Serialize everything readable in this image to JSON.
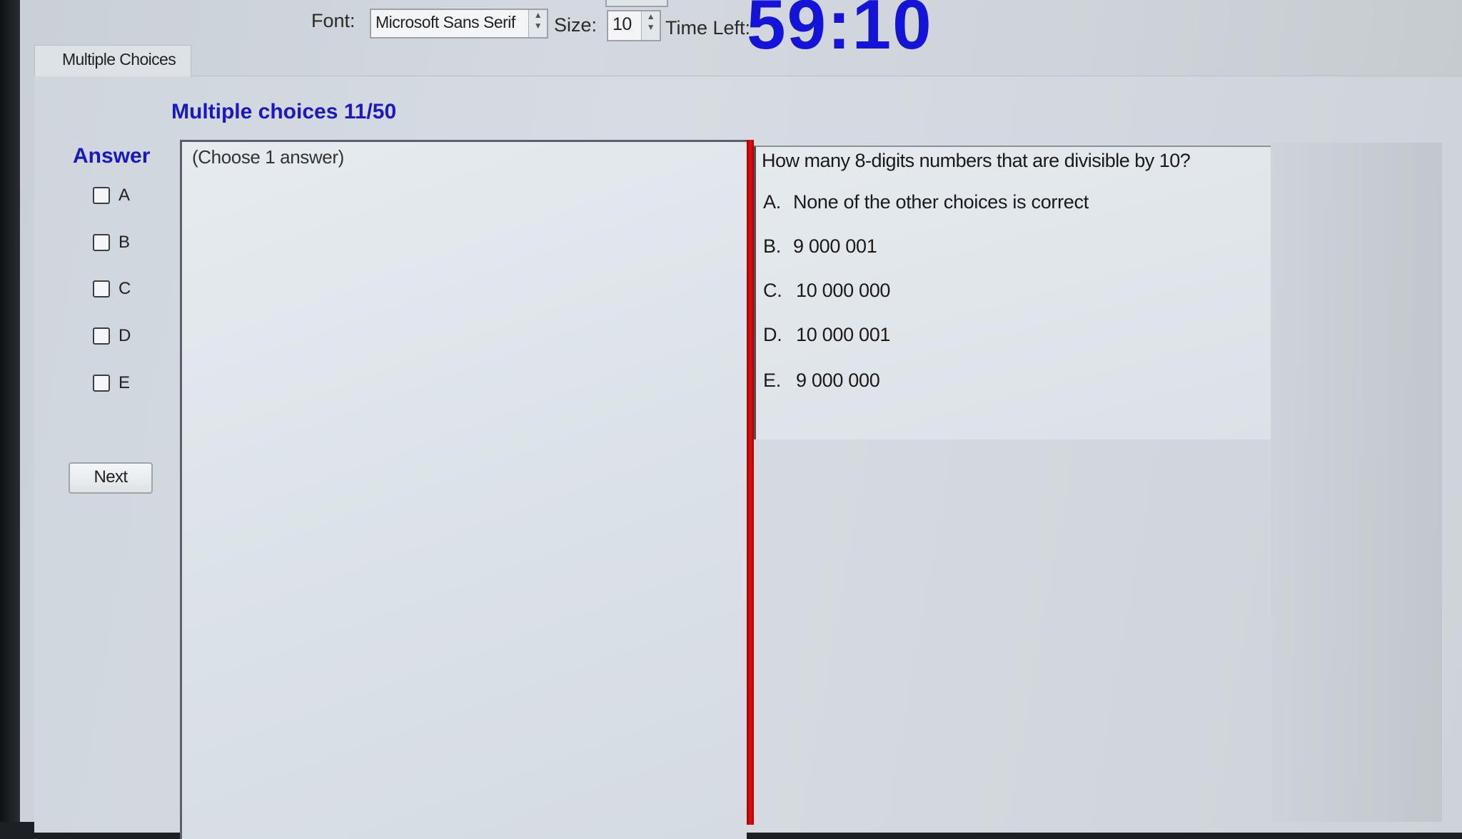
{
  "toolbar": {
    "font_label": "Font:",
    "font_value": "Microsoft Sans Serif",
    "size_label": "Size:",
    "size_value": "10",
    "time_label": "Time Left:",
    "time_value": "59:10"
  },
  "tab": {
    "label": "Multiple Choices"
  },
  "section_title": "Multiple choices 11/50",
  "answer_sidebar": {
    "header": "Answer",
    "options": [
      {
        "label": "A",
        "checked": false
      },
      {
        "label": "B",
        "checked": false
      },
      {
        "label": "C",
        "checked": false
      },
      {
        "label": "D",
        "checked": false
      },
      {
        "label": "E",
        "checked": false
      }
    ],
    "next_label": "Next"
  },
  "answer_panel": {
    "hint": "(Choose 1 answer)"
  },
  "question": {
    "text": "How many 8-digits numbers that are divisible by 10?",
    "choices": [
      {
        "letter": "A.",
        "text": "None of the other choices is correct"
      },
      {
        "letter": "B.",
        "text": "9 000 001"
      },
      {
        "letter": "C.",
        "text": "10 000 000"
      },
      {
        "letter": "D.",
        "text": "10 000 001"
      },
      {
        "letter": "E.",
        "text": "9 000 000"
      }
    ]
  },
  "colors": {
    "accent_blue": "#1414d8",
    "divider_red": "#d00000"
  }
}
